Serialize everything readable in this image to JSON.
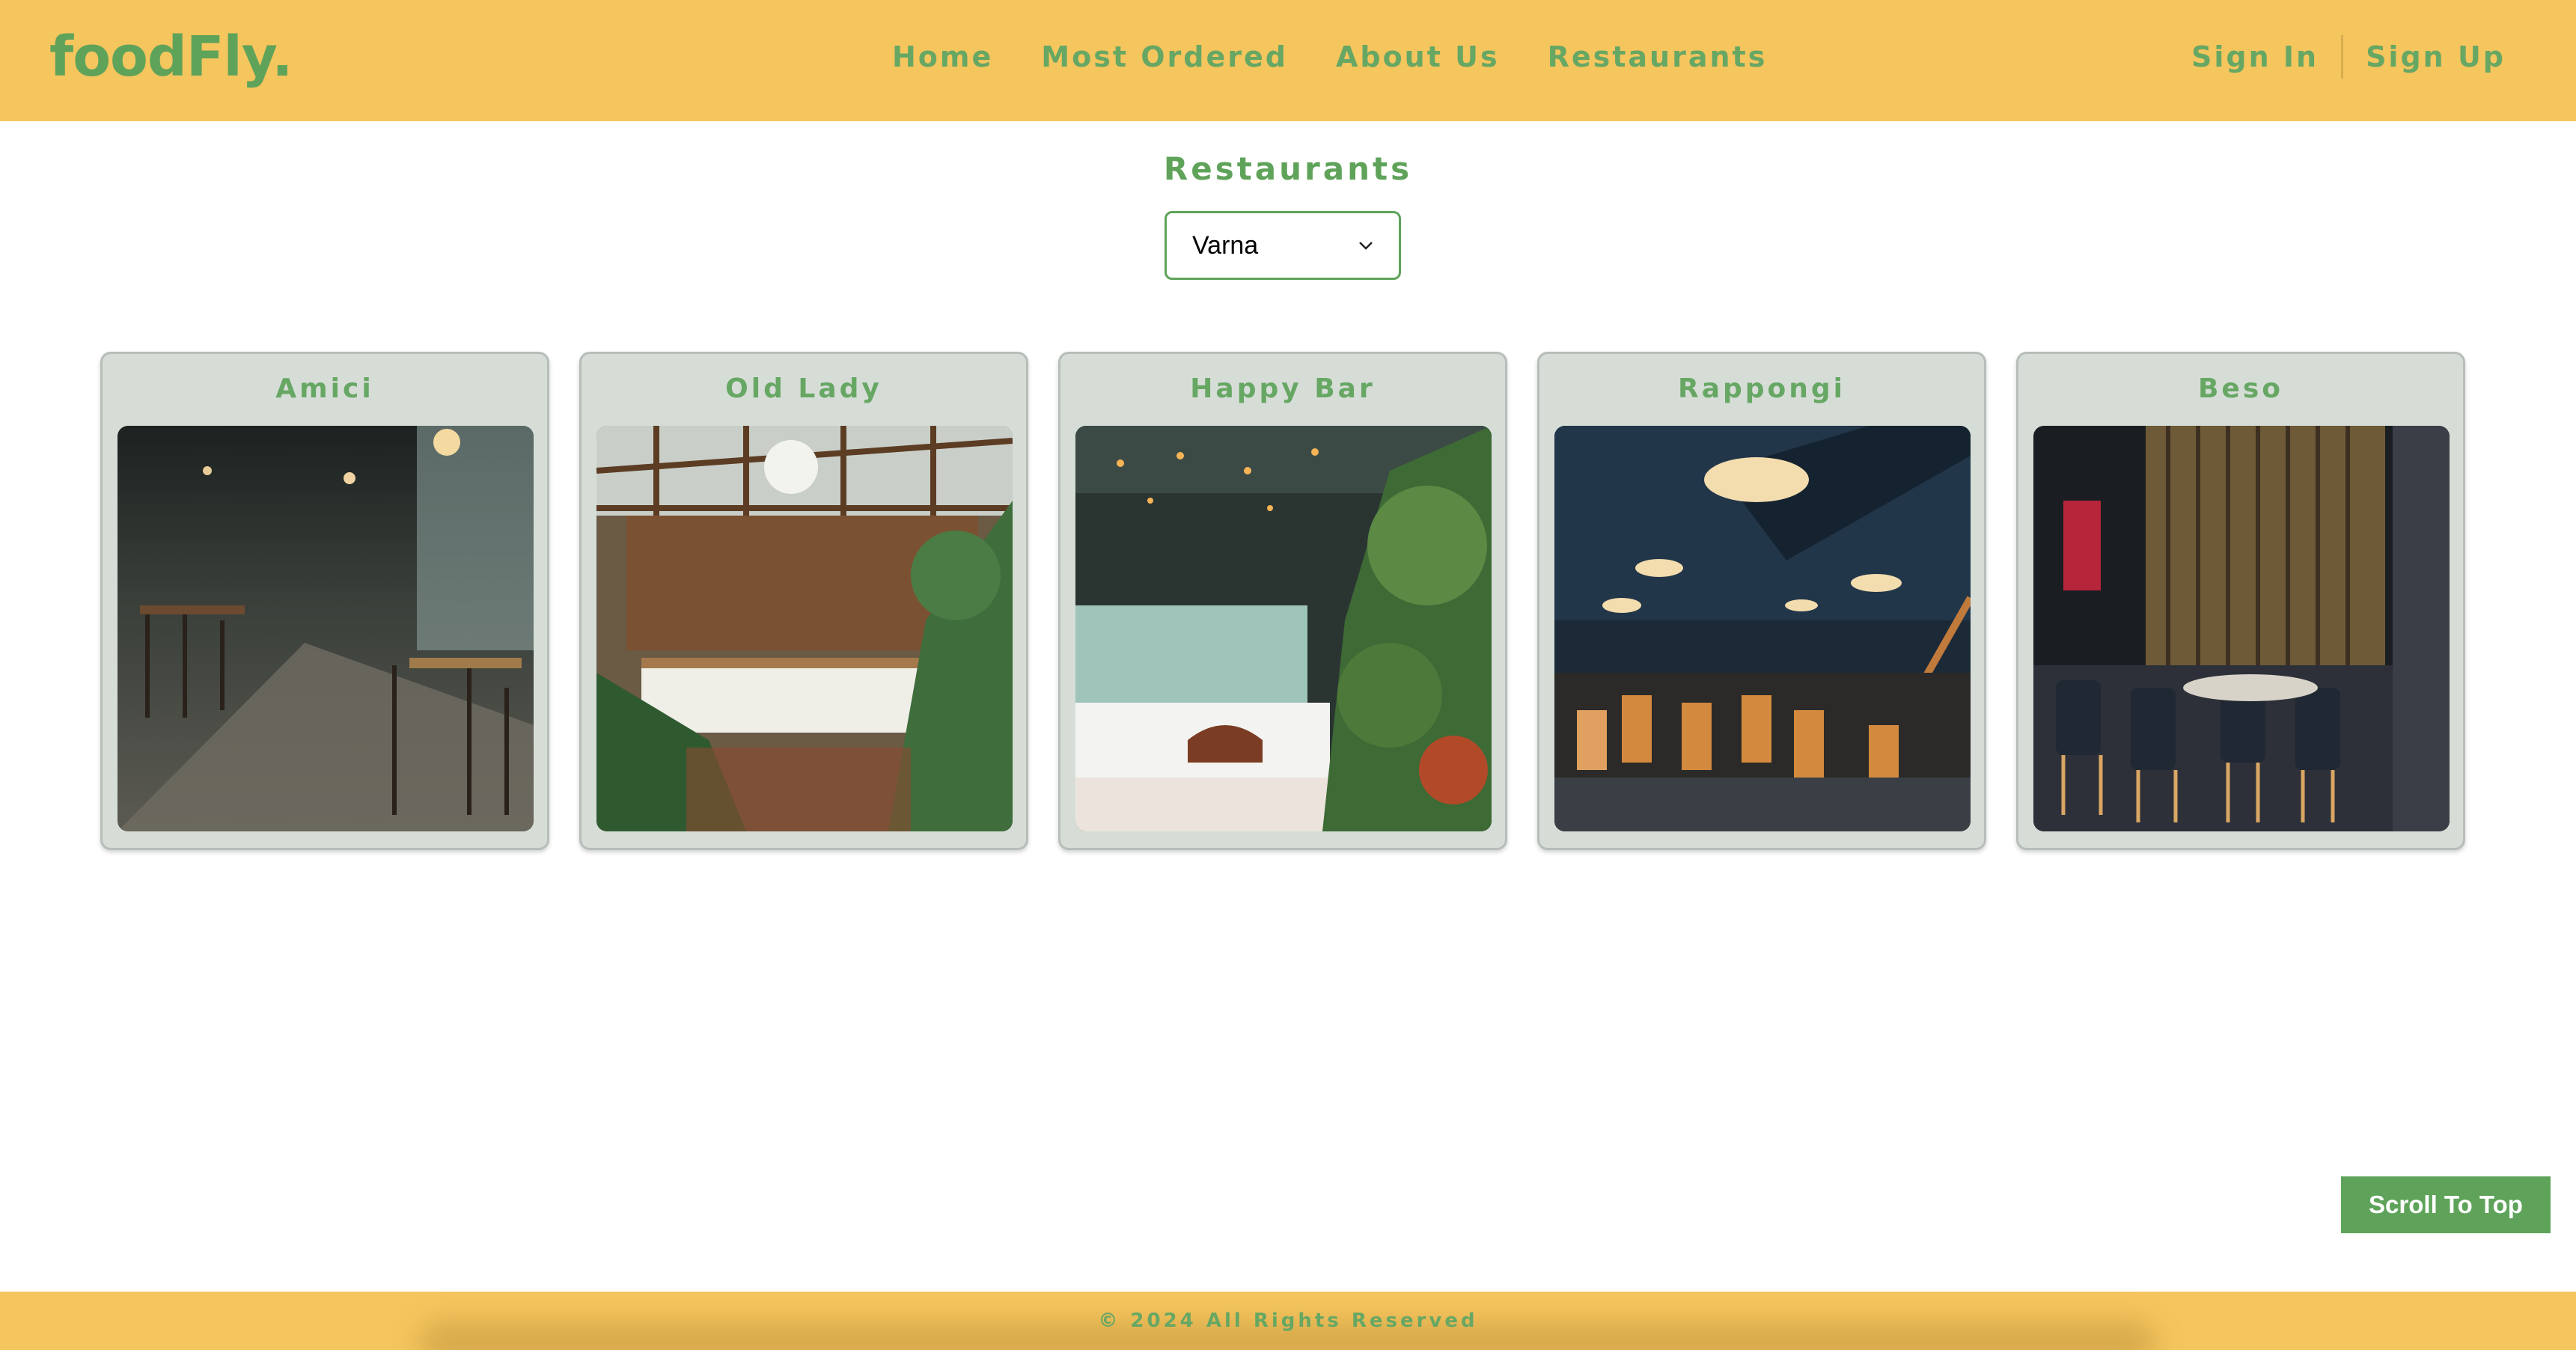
{
  "header": {
    "logo": "foodFly.",
    "nav": [
      "Home",
      "Most Ordered",
      "About Us",
      "Restaurants"
    ],
    "auth": {
      "sign_in": "Sign In",
      "sign_up": "Sign Up"
    }
  },
  "main": {
    "title": "Restaurants",
    "city_select": {
      "selected": "Varna"
    },
    "restaurants": [
      {
        "name": "Amici"
      },
      {
        "name": "Old Lady"
      },
      {
        "name": "Happy Bar"
      },
      {
        "name": "Rappongi"
      },
      {
        "name": "Beso"
      }
    ]
  },
  "scroll_top": {
    "label": "Scroll To Top"
  },
  "footer": {
    "text": "© 2024 All Rights Reserved"
  },
  "colors": {
    "header_bg": "#f5c55e",
    "accent_green": "#5fa35a",
    "card_bg": "#d6ddd7"
  },
  "icons": {
    "select_arrow": "chevron-down-icon"
  }
}
